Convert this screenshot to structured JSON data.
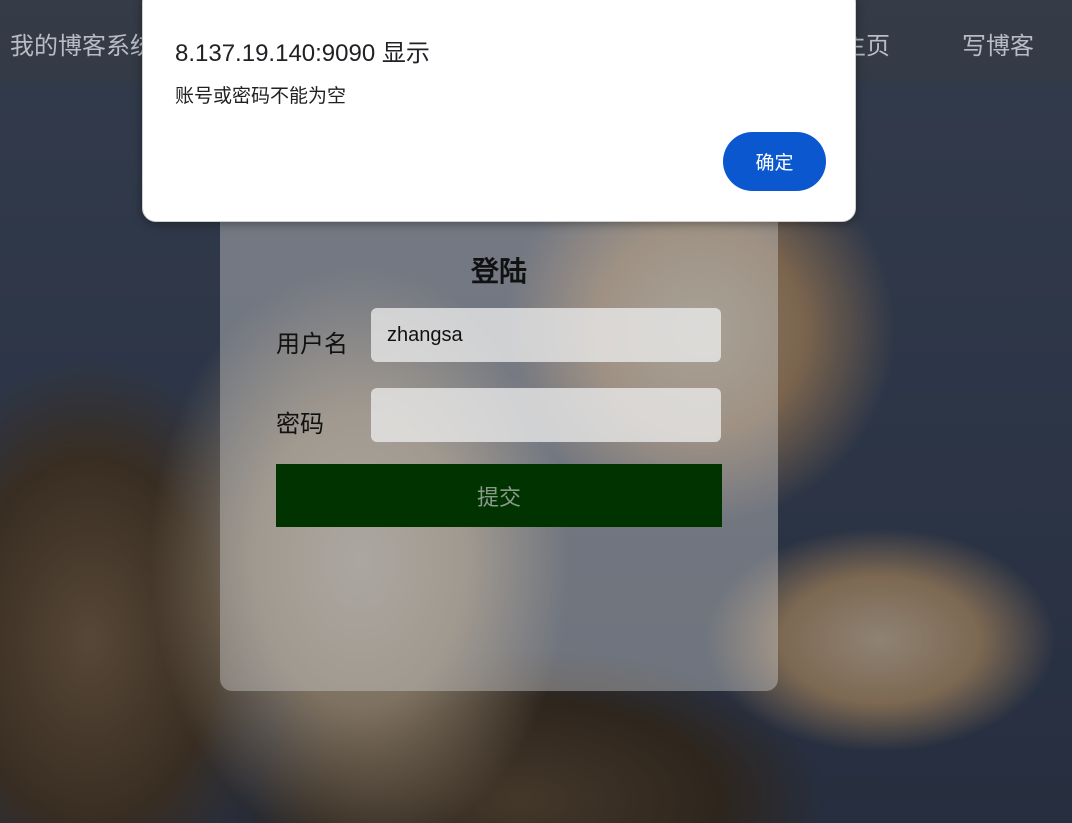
{
  "nav": {
    "title": "我的博客系统",
    "home_label": "主页",
    "write_label": "写博客"
  },
  "login": {
    "title": "登陆",
    "username_label": "用户名",
    "username_value": "zhangsa",
    "password_label": "密码",
    "password_value": "",
    "submit_label": "提交"
  },
  "alert": {
    "origin": "8.137.19.140:9090 显示",
    "message": "账号或密码不能为空",
    "ok_label": "确定"
  },
  "colors": {
    "submit_bg": "#003300",
    "ok_button_bg": "#0b57d0"
  }
}
